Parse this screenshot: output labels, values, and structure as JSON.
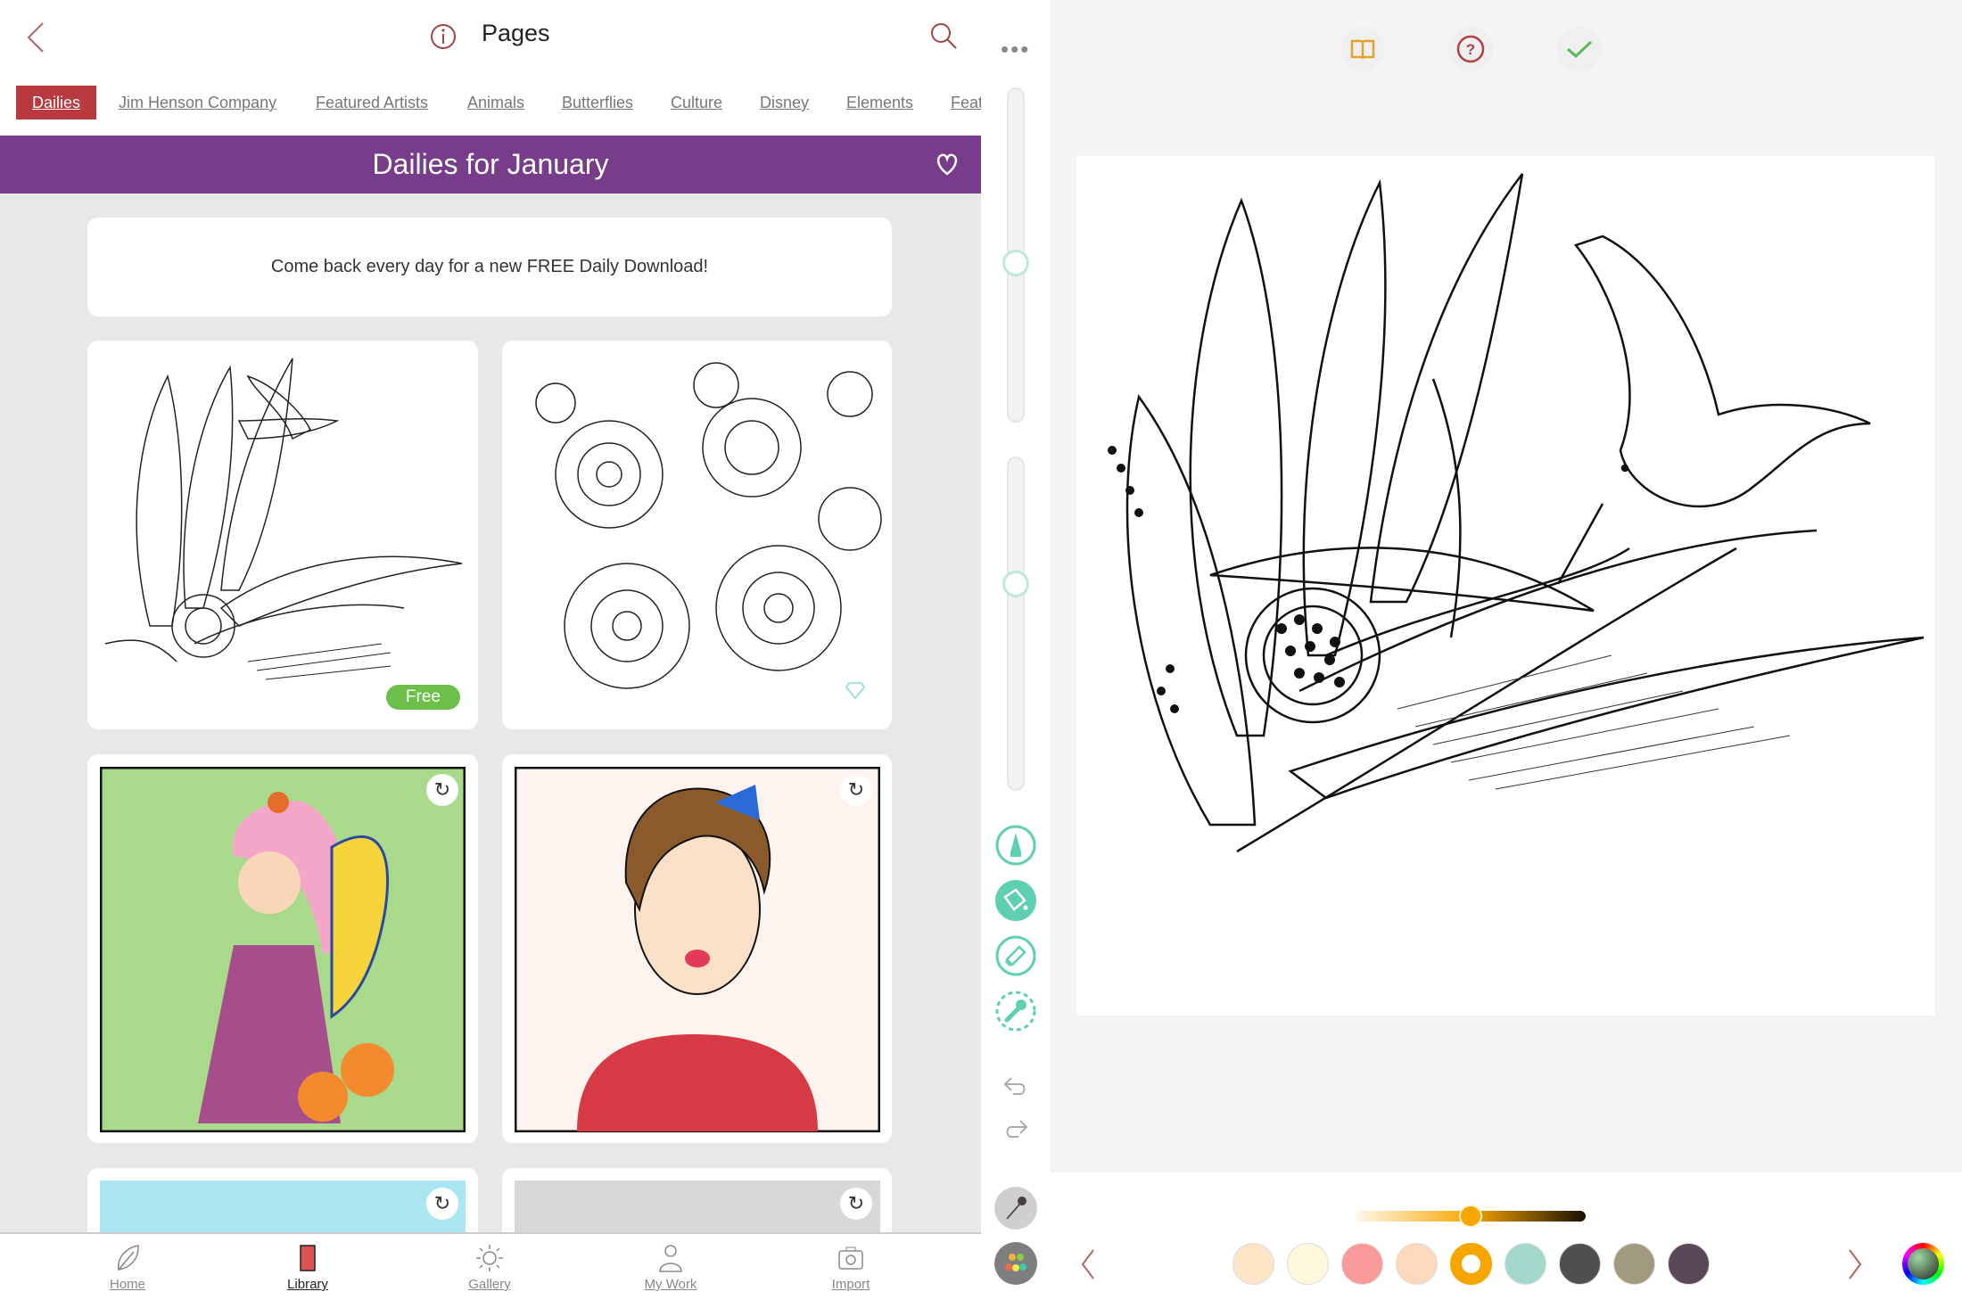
{
  "header": {
    "title": "Pages",
    "back_icon": "chevron-left-icon",
    "info_icon": "info-icon",
    "search_icon": "search-icon"
  },
  "tabs": [
    {
      "label": "Dailies",
      "active": true
    },
    {
      "label": "Jim Henson Company"
    },
    {
      "label": "Featured Artists"
    },
    {
      "label": "Animals"
    },
    {
      "label": "Butterflies"
    },
    {
      "label": "Culture"
    },
    {
      "label": "Disney"
    },
    {
      "label": "Elements"
    },
    {
      "label": "Feat"
    }
  ],
  "banner": {
    "title": "Dailies for January",
    "icon": "heart-icon"
  },
  "message": "Come back every day for a new FREE Daily Download!",
  "cards": [
    {
      "badge": "Free",
      "badge_color": "#6cc04a"
    },
    {
      "badge_icon": "diamond-icon"
    },
    {
      "icon": "recolor-icon"
    },
    {
      "icon": "recolor-icon"
    },
    {
      "icon": "recolor-icon"
    },
    {
      "icon": "recolor-icon"
    }
  ],
  "nav": [
    {
      "label": "Home"
    },
    {
      "label": "Library",
      "active": true
    },
    {
      "label": "Gallery"
    },
    {
      "label": "My Work"
    },
    {
      "label": "Import"
    }
  ],
  "colors": {
    "accent": "#b83a3e",
    "banner": "#773d8a",
    "tool": "#5ecfb1"
  },
  "editor": {
    "top_icons": [
      "book-icon",
      "help-icon",
      "check-icon"
    ],
    "tools": [
      "marker-icon",
      "paint-bucket-icon",
      "eraser-icon",
      "wrench-icon"
    ],
    "shade_value": 0.5,
    "swatches": [
      "#fde6c8",
      "#fff8dc",
      "#f89a9a",
      "#fcd9bc",
      "#f7a600",
      "#a4d7cc",
      "#4e4f4e",
      "#a19a7e",
      "#5a4758"
    ],
    "selected_swatch": 4
  }
}
